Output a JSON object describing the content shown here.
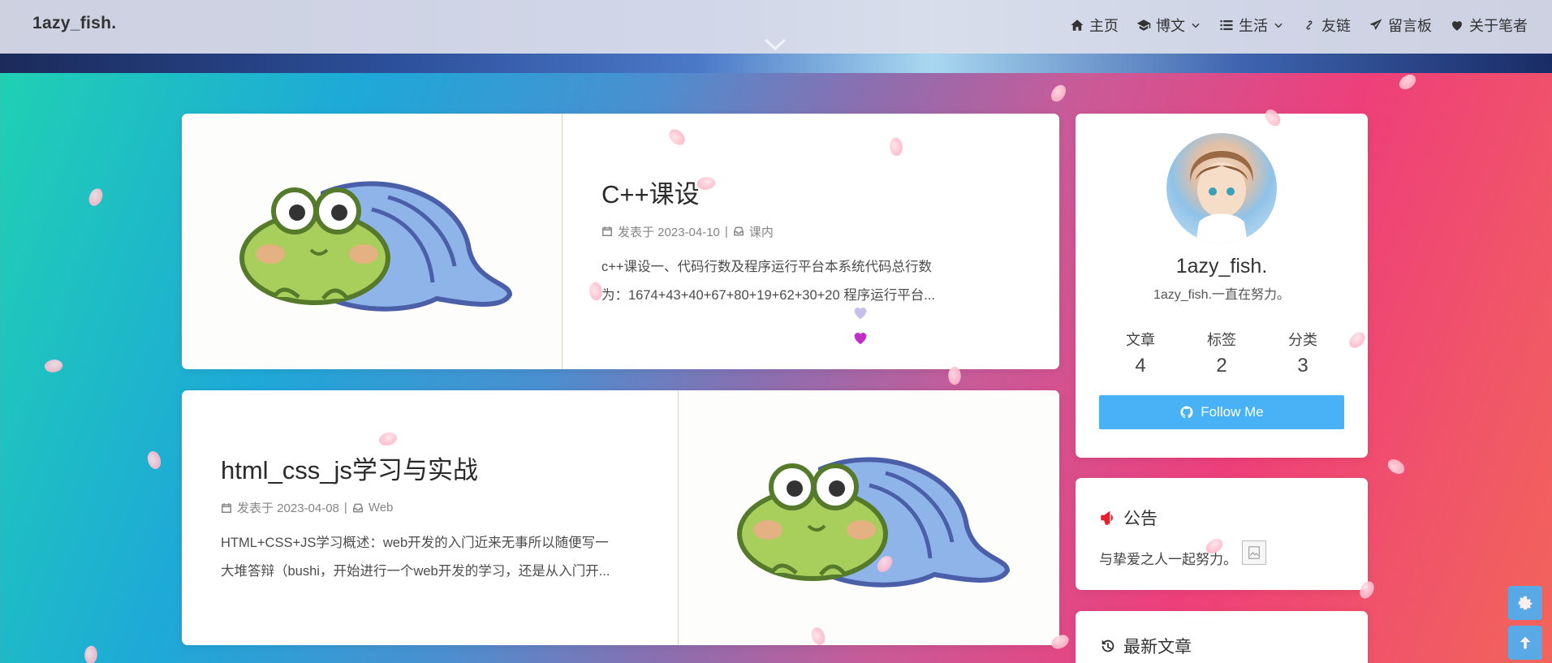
{
  "site": {
    "brand": "1azy_fish."
  },
  "nav": {
    "items": [
      {
        "label": "主页",
        "icon": "home-icon",
        "dropdown": false
      },
      {
        "label": "博文",
        "icon": "graduation-cap-icon",
        "dropdown": true
      },
      {
        "label": "生活",
        "icon": "list-icon",
        "dropdown": true
      },
      {
        "label": "友链",
        "icon": "link-icon",
        "dropdown": false
      },
      {
        "label": "留言板",
        "icon": "paper-plane-icon",
        "dropdown": false
      },
      {
        "label": "关于笔者",
        "icon": "heart-icon",
        "dropdown": false
      }
    ]
  },
  "posts": [
    {
      "title": "C++课设",
      "date_label": "发表于 2023-04-10",
      "separator": "|",
      "category": "课内",
      "excerpt_line1": "c++课设一、代码行数及程序运行平台本系统代码总行数",
      "excerpt_line2": "为：1674+43+40+67+80+19+62+30+20 程序运行平台..."
    },
    {
      "title": "html_css_js学习与实战",
      "date_label": "发表于 2023-04-08",
      "separator": "|",
      "category": "Web",
      "excerpt_line1": "HTML+CSS+JS学习概述：web开发的入门近来无事所以随便写一",
      "excerpt_line2": "大堆答辩（bushi，开始进行一个web开发的学习，还是从入门开..."
    }
  ],
  "profile": {
    "name": "1azy_fish.",
    "description": "1azy_fish.一直在努力。",
    "stats": [
      {
        "label": "文章",
        "value": "4"
      },
      {
        "label": "标签",
        "value": "2"
      },
      {
        "label": "分类",
        "value": "3"
      }
    ],
    "follow_label": "Follow Me"
  },
  "notice": {
    "title": "公告",
    "body": "与挚爱之人一起努力。"
  },
  "recent": {
    "title": "最新文章"
  },
  "colors": {
    "accent": "#49b1f5",
    "heart": "#c02fc6",
    "notice_icon": "#e61e2e"
  }
}
